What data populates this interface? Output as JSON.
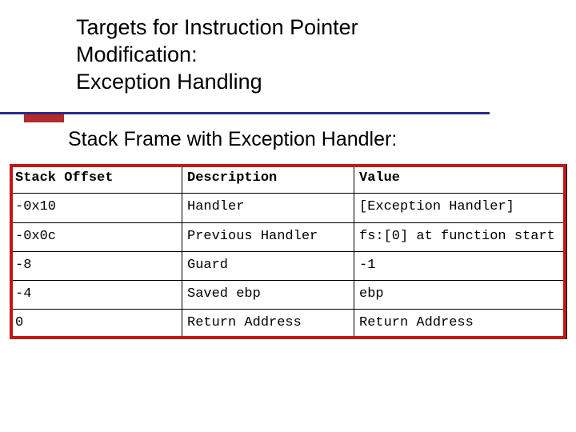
{
  "title": {
    "line1": "Targets for Instruction Pointer",
    "line2": "Modification:",
    "line3": "Exception Handling"
  },
  "subtitle": "Stack Frame with Exception Handler:",
  "table": {
    "headers": {
      "col1": "Stack Offset",
      "col2": "Description",
      "col3": "Value"
    },
    "rows": [
      {
        "offset": "-0x10",
        "desc": "Handler",
        "value": "[Exception Handler]"
      },
      {
        "offset": "-0x0c",
        "desc": "Previous Handler",
        "value": "fs:[0] at function start"
      },
      {
        "offset": "-8",
        "desc": "Guard",
        "value": "-1"
      },
      {
        "offset": "-4",
        "desc": "Saved ebp",
        "value": "ebp"
      },
      {
        "offset": "0",
        "desc": "Return Address",
        "value": "Return Address"
      }
    ]
  },
  "chart_data": {
    "type": "table",
    "title": "Stack Frame with Exception Handler",
    "columns": [
      "Stack Offset",
      "Description",
      "Value"
    ],
    "rows": [
      [
        "-0x10",
        "Handler",
        "[Exception Handler]"
      ],
      [
        "-0x0c",
        "Previous Handler",
        "fs:[0] at function start"
      ],
      [
        "-8",
        "Guard",
        "-1"
      ],
      [
        "-4",
        "Saved ebp",
        "ebp"
      ],
      [
        "0",
        "Return Address",
        "Return Address"
      ]
    ]
  }
}
